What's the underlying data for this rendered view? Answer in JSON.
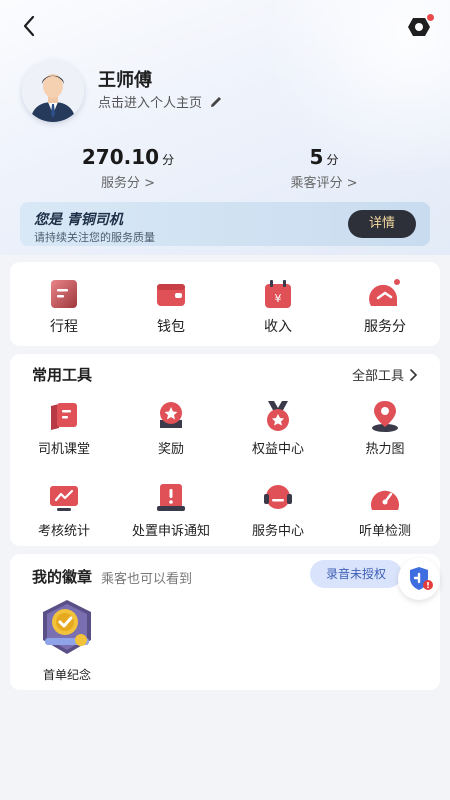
{
  "header": {
    "back_icon": "chevron-left-icon",
    "message_icon": "message-icon"
  },
  "profile": {
    "name": "王师傅",
    "link_text": "点击进入个人主页",
    "edit_icon": "pencil-icon"
  },
  "stats": [
    {
      "value": "270.10",
      "unit": "分",
      "label": "服务分 >"
    },
    {
      "value": "5",
      "unit": "分",
      "label": "乘客评分 >"
    }
  ],
  "level": {
    "title": "您是 青铜司机",
    "subtitle": "请持续关注您的服务质量",
    "button": "详情"
  },
  "quick": [
    {
      "label": "行程",
      "icon": "trip-icon"
    },
    {
      "label": "钱包",
      "icon": "wallet-icon"
    },
    {
      "label": "收入",
      "icon": "income-icon"
    },
    {
      "label": "服务分",
      "icon": "service-score-icon"
    }
  ],
  "tools": {
    "title": "常用工具",
    "all_label": "全部工具",
    "items": [
      {
        "label": "司机课堂",
        "icon": "classroom-icon"
      },
      {
        "label": "奖励",
        "icon": "reward-icon"
      },
      {
        "label": "权益中心",
        "icon": "benefits-icon"
      },
      {
        "label": "热力图",
        "icon": "heatmap-icon"
      },
      {
        "label": "考核统计",
        "icon": "statistics-icon"
      },
      {
        "label": "处置申诉通知",
        "icon": "appeal-icon"
      },
      {
        "label": "服务中心",
        "icon": "service-center-icon"
      },
      {
        "label": "听单检测",
        "icon": "order-detection-icon"
      }
    ]
  },
  "badges": {
    "title": "我的徽章",
    "subtitle": "乘客也可以看到",
    "recording_status": "录音未授权",
    "items": [
      {
        "name": "首单纪念",
        "icon": "first-order-badge-icon"
      }
    ]
  },
  "colors": {
    "accent_red": "#e05157",
    "detail_button_bg": "#2d3038",
    "detail_button_text": "#f5d8a0",
    "recording_pill_bg": "#d9e3fb"
  }
}
